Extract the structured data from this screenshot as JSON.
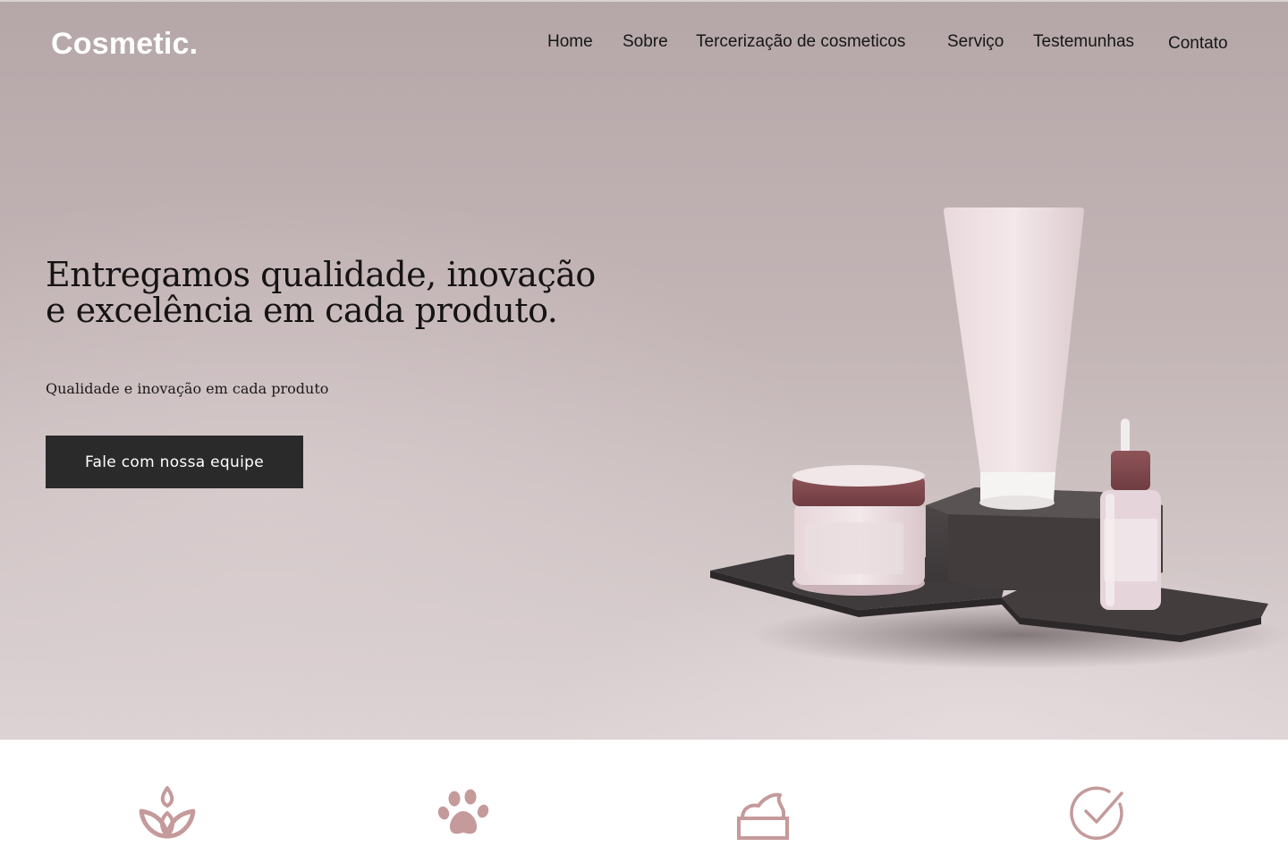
{
  "brand": {
    "logo_text": "Cosmetic."
  },
  "nav": {
    "items": [
      {
        "label": "Home"
      },
      {
        "label": "Sobre"
      },
      {
        "label": "Tercerização de cosmeticos"
      },
      {
        "label": "Serviço"
      },
      {
        "label": "Testemunhas"
      },
      {
        "label": "Contato"
      }
    ]
  },
  "hero": {
    "headline": "Entregamos qualidade, inovação e excelência em cada produto.",
    "subheadline": "Qualidade e inovação em cada produto",
    "cta_label": "Fale com nossa equipe"
  },
  "features": {
    "icons": [
      {
        "icon": "lotus-leaf-icon"
      },
      {
        "icon": "paw-print-icon"
      },
      {
        "icon": "cream-jar-icon"
      },
      {
        "icon": "check-circle-icon"
      }
    ]
  },
  "colors": {
    "accent": "#c49a9a",
    "button_bg": "#2a2a2b",
    "logo": "#ffffff",
    "nav_text": "#161616"
  }
}
